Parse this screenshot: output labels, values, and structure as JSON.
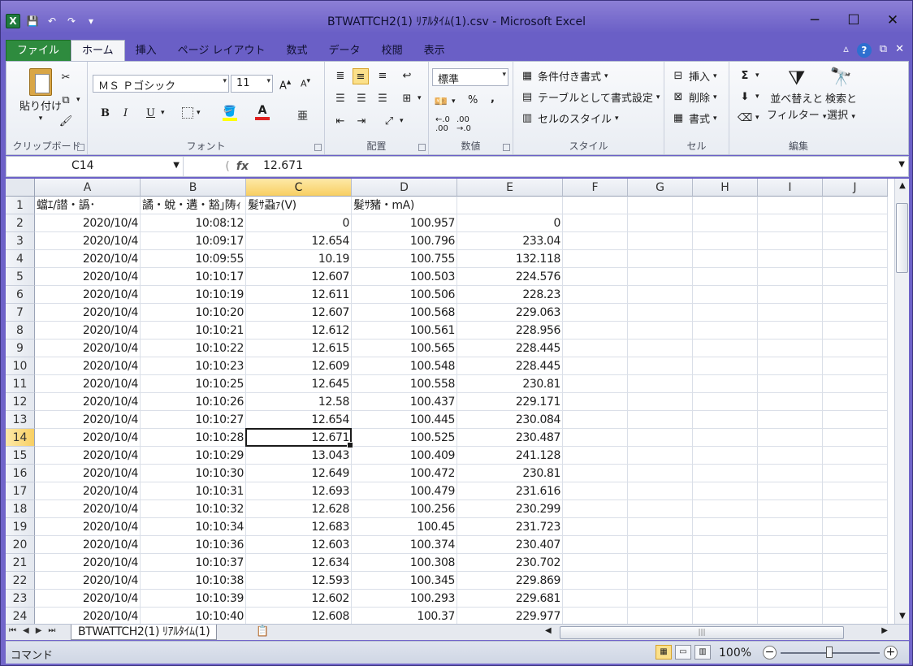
{
  "window": {
    "title": "BTWATTCH2(1) ﾘｱﾙﾀｲﾑ(1).csv - Microsoft Excel",
    "minimize": "─",
    "maximize": "☐",
    "close": "✕"
  },
  "qat": {
    "logo": "X",
    "save": "💾",
    "undo": "↶",
    "redo": "↷",
    "customize": "▾"
  },
  "tabs": [
    {
      "label": "ファイル"
    },
    {
      "label": "ホーム"
    },
    {
      "label": "挿入"
    },
    {
      "label": "ページ レイアウト"
    },
    {
      "label": "数式"
    },
    {
      "label": "データ"
    },
    {
      "label": "校閲"
    },
    {
      "label": "表示"
    }
  ],
  "ribbon": {
    "clipboard": {
      "label": "クリップボード",
      "paste": "貼り付け"
    },
    "font": {
      "label": "フォント",
      "name": "ＭＳ Ｐゴシック",
      "size": "11",
      "bold": "B",
      "italic": "I",
      "underline": "U"
    },
    "alignment": {
      "label": "配置"
    },
    "number": {
      "label": "数値",
      "format": "標準",
      "percent": "%",
      "comma": ","
    },
    "styles": {
      "label": "スタイル",
      "conditional": "条件付き書式",
      "table": "テーブルとして書式設定",
      "cell_styles": "セルのスタイル"
    },
    "cells": {
      "label": "セル",
      "insert": "挿入",
      "delete": "削除",
      "format": "書式"
    },
    "editing": {
      "label": "編集",
      "sort": "並べ替えと",
      "sort2": "フィルター",
      "find": "検索と",
      "find2": "選択"
    }
  },
  "formula_bar": {
    "name_box": "C14",
    "fx": "fx",
    "value": "12.671"
  },
  "columns": [
    "A",
    "B",
    "C",
    "D",
    "E",
    "F",
    "G",
    "H",
    "I",
    "J"
  ],
  "header_row": [
    "蟷ｴ/譛・譌･",
    "譎・蛻・遘・豁｣陦ｨ",
    "髮ｻ蝨ｧ(V)",
    "髮ｻ豬・mA)",
    "",
    "",
    "",
    "",
    "",
    ""
  ],
  "rows": [
    [
      "2020/10/4",
      "10:08:12",
      "0",
      "100.957",
      "0"
    ],
    [
      "2020/10/4",
      "10:09:17",
      "12.654",
      "100.796",
      "233.04"
    ],
    [
      "2020/10/4",
      "10:09:55",
      "10.19",
      "100.755",
      "132.118"
    ],
    [
      "2020/10/4",
      "10:10:17",
      "12.607",
      "100.503",
      "224.576"
    ],
    [
      "2020/10/4",
      "10:10:19",
      "12.611",
      "100.506",
      "228.23"
    ],
    [
      "2020/10/4",
      "10:10:20",
      "12.607",
      "100.568",
      "229.063"
    ],
    [
      "2020/10/4",
      "10:10:21",
      "12.612",
      "100.561",
      "228.956"
    ],
    [
      "2020/10/4",
      "10:10:22",
      "12.615",
      "100.565",
      "228.445"
    ],
    [
      "2020/10/4",
      "10:10:23",
      "12.609",
      "100.548",
      "228.445"
    ],
    [
      "2020/10/4",
      "10:10:25",
      "12.645",
      "100.558",
      "230.81"
    ],
    [
      "2020/10/4",
      "10:10:26",
      "12.58",
      "100.437",
      "229.171"
    ],
    [
      "2020/10/4",
      "10:10:27",
      "12.654",
      "100.445",
      "230.084"
    ],
    [
      "2020/10/4",
      "10:10:28",
      "12.671",
      "100.525",
      "230.487"
    ],
    [
      "2020/10/4",
      "10:10:29",
      "13.043",
      "100.409",
      "241.128"
    ],
    [
      "2020/10/4",
      "10:10:30",
      "12.649",
      "100.472",
      "230.81"
    ],
    [
      "2020/10/4",
      "10:10:31",
      "12.693",
      "100.479",
      "231.616"
    ],
    [
      "2020/10/4",
      "10:10:32",
      "12.628",
      "100.256",
      "230.299"
    ],
    [
      "2020/10/4",
      "10:10:34",
      "12.683",
      "100.45",
      "231.723"
    ],
    [
      "2020/10/4",
      "10:10:36",
      "12.603",
      "100.374",
      "230.407"
    ],
    [
      "2020/10/4",
      "10:10:37",
      "12.634",
      "100.308",
      "230.702"
    ],
    [
      "2020/10/4",
      "10:10:38",
      "12.593",
      "100.345",
      "229.869"
    ],
    [
      "2020/10/4",
      "10:10:39",
      "12.602",
      "100.293",
      "229.681"
    ],
    [
      "2020/10/4",
      "10:10:40",
      "12.608",
      "100.37",
      "229.977"
    ]
  ],
  "active_cell": {
    "col": "C",
    "row": 14
  },
  "sheet_tab": "BTWATTCH2(1) ﾘｱﾙﾀｲﾑ(1)",
  "status": {
    "mode": "コマンド",
    "zoom": "100%"
  }
}
